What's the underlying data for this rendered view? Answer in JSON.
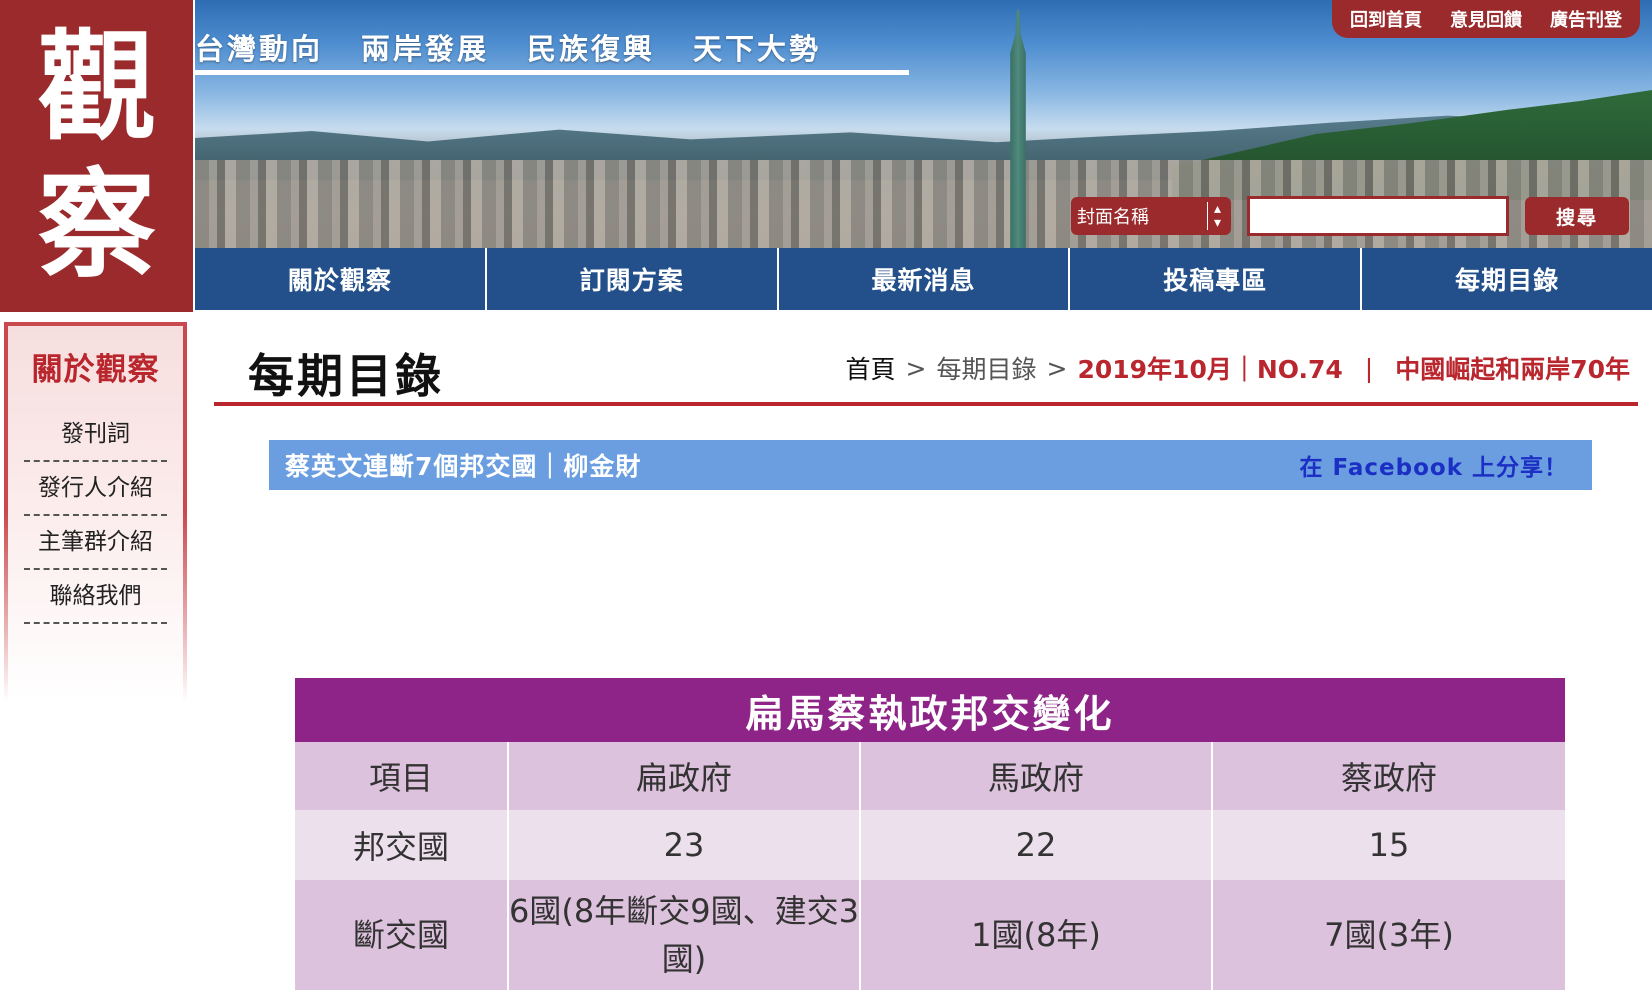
{
  "logo": {
    "char1": "觀",
    "char2": "察"
  },
  "banner": {
    "taglines": [
      "台灣動向",
      "兩岸發展",
      "民族復興",
      "天下大勢"
    ],
    "top_links": [
      "回到首頁",
      "意見回饋",
      "廣告刊登"
    ],
    "search": {
      "select_value": "封面名稱",
      "input_value": "",
      "button": "搜尋"
    }
  },
  "main_nav": [
    "關於觀察",
    "訂閱方案",
    "最新消息",
    "投稿專區",
    "每期目錄"
  ],
  "sidebar": {
    "title": "關於觀察",
    "items": [
      "發刊詞",
      "發行人介紹",
      "主筆群介紹",
      "聯絡我們"
    ]
  },
  "page": {
    "title": "每期目錄",
    "breadcrumb": {
      "home": "首頁",
      "sep": ">",
      "section": "每期目錄",
      "issue": "2019年10月｜NO.74",
      "divider": "|",
      "topic": "中國崛起和兩岸70年"
    }
  },
  "article": {
    "title": "蔡英文連斷7個邦交國｜柳金財",
    "share": "在 Facebook 上分享！"
  },
  "table": {
    "caption": "扁馬蔡執政邦交變化",
    "headers": [
      "項目",
      "扁政府",
      "馬政府",
      "蔡政府"
    ],
    "rows": [
      [
        "邦交國",
        "23",
        "22",
        "15"
      ],
      [
        "斷交國",
        "6國(8年斷交9國、建交3國)",
        "1國(8年)",
        "7國(3年)"
      ]
    ]
  },
  "colors": {
    "brand_red": "#9a2a2c",
    "nav_blue": "#23508a",
    "share_bar": "#6a9ee0",
    "table_purple": "#8e2487"
  }
}
